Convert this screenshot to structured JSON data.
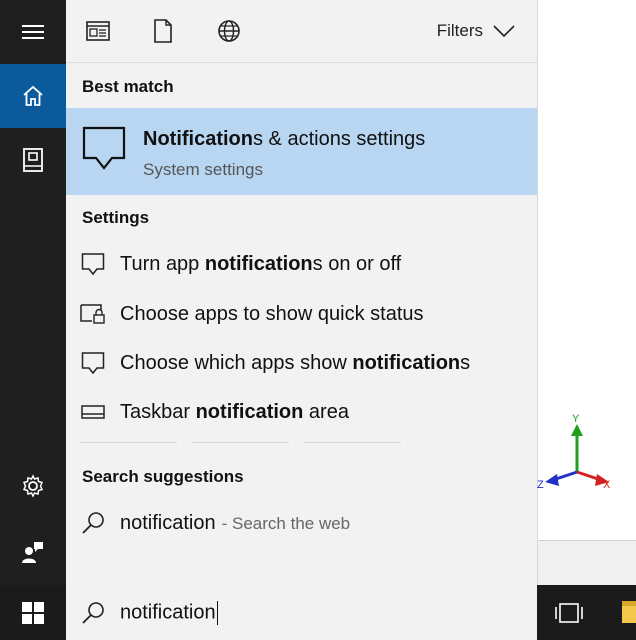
{
  "filters": {
    "label": "Filters"
  },
  "sections": {
    "best_match": "Best match",
    "settings": "Settings",
    "search_suggestions": "Search suggestions"
  },
  "best_match": {
    "title_bold": "Notification",
    "title_rest": "s & actions settings",
    "subtitle": "System settings",
    "icon": "speech-bubble-icon"
  },
  "settings_results": [
    {
      "pre": "Turn app ",
      "bold": "notification",
      "post": "s on or off",
      "icon": "speech-bubble-icon"
    },
    {
      "pre": "Choose apps to show quick status",
      "bold": "",
      "post": "",
      "icon": "lock-screen-icon"
    },
    {
      "pre": "Choose which apps show ",
      "bold": "notification",
      "post": "s",
      "icon": "speech-bubble-icon"
    },
    {
      "pre": "Taskbar ",
      "bold": "notification",
      "post": " area",
      "icon": "taskbar-icon"
    }
  ],
  "suggestion": {
    "query": "notification",
    "hint": "- Search the web",
    "icon": "search-icon"
  },
  "search": {
    "value": "notification",
    "icon": "search-icon"
  },
  "axis": {
    "x": "X",
    "y": "Y",
    "z": "Z"
  },
  "colors": {
    "rail": "#1f1f1f",
    "rail_active": "#0b5a9c",
    "panel": "#f2f2f2",
    "highlight": "#b8d6f2",
    "taskbar": "#1b1b1b"
  }
}
